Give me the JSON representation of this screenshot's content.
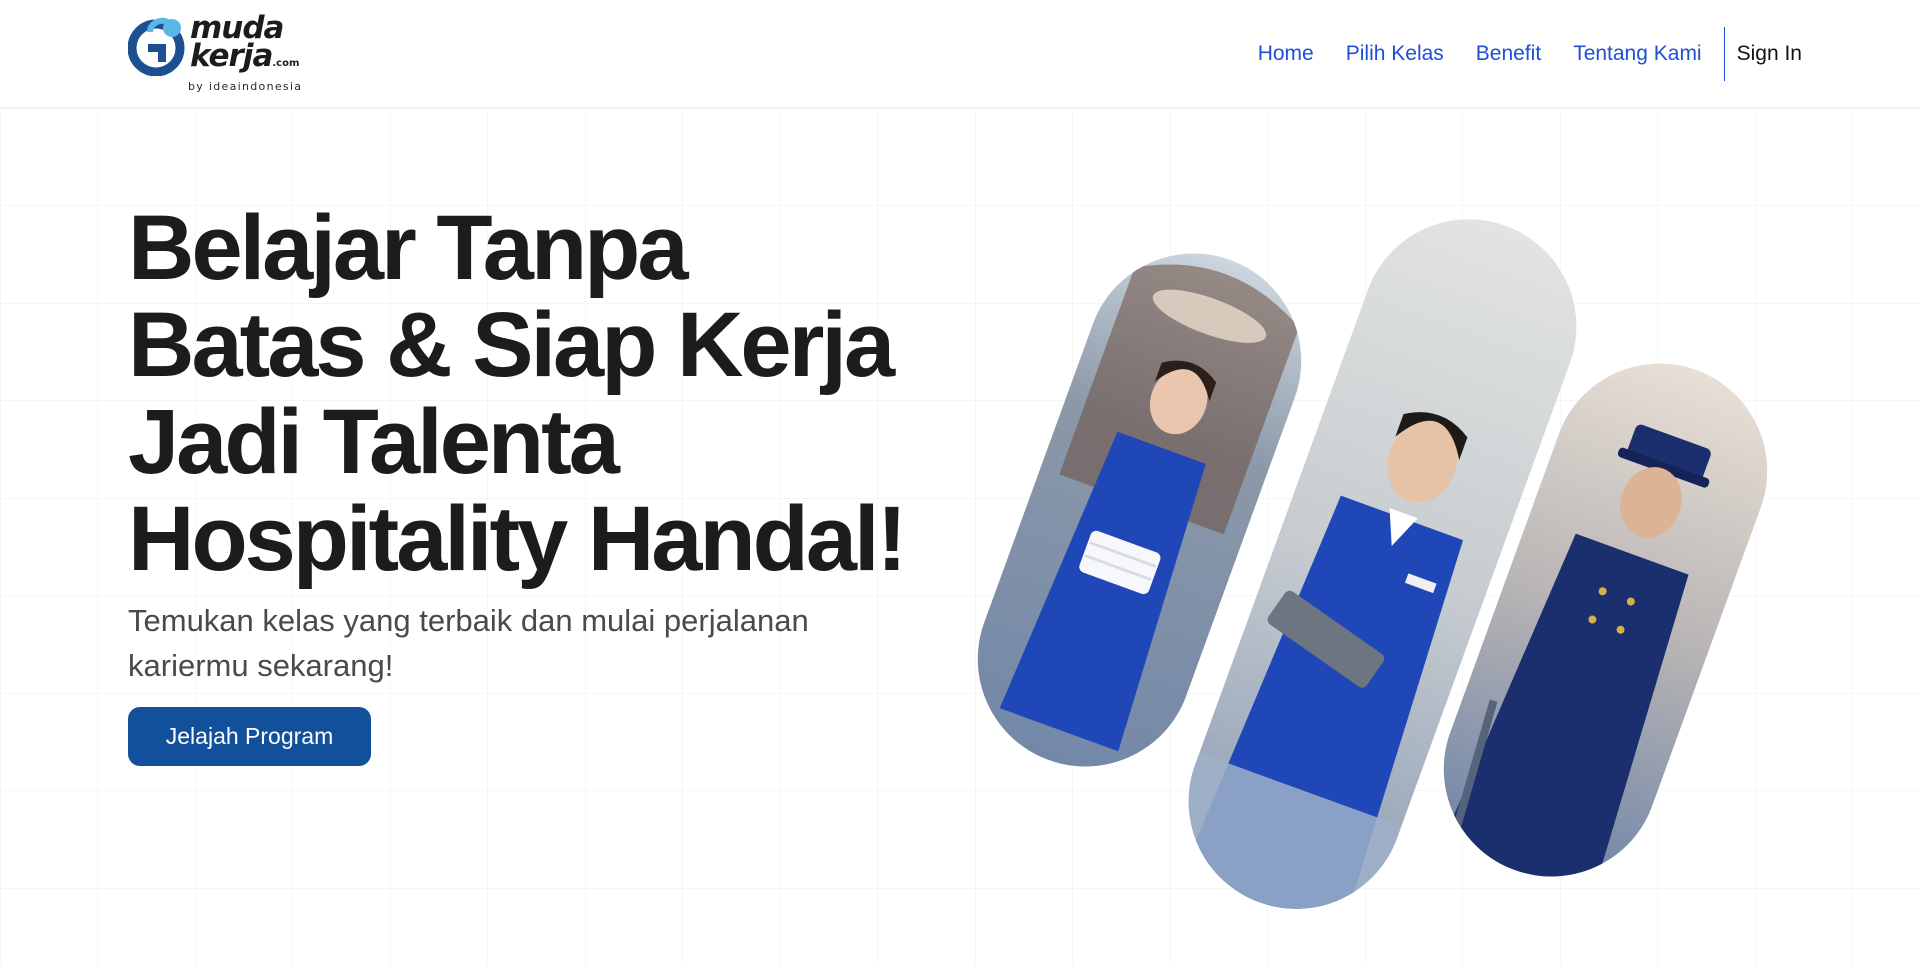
{
  "brand": {
    "name_line1": "muda",
    "name_line2": "kerja",
    "name_suffix": ".com",
    "tagline": "by ideaindonesia",
    "colors": {
      "mark_dark": "#1d4f91",
      "mark_light": "#5bb7e6",
      "text": "#1c1c1c"
    }
  },
  "nav": {
    "items": [
      {
        "label": "Home"
      },
      {
        "label": "Pilih Kelas"
      },
      {
        "label": "Benefit"
      },
      {
        "label": "Tentang Kami"
      }
    ],
    "signin_label": "Sign In",
    "link_color": "#1d4fd8"
  },
  "hero": {
    "headline_lines": [
      "Belajar Tanpa",
      "Batas & Siap Kerja",
      "Jadi Talenta",
      "Hospitality Handal!"
    ],
    "subtext_line1": "Temukan kelas yang terbaik dan mulai perjalanan",
    "subtext_line2": "kariermu sekarang!",
    "cta_label": "Jelajah Program",
    "cta_color": "#12509c"
  },
  "images": [
    {
      "name": "housekeeper-photo",
      "subject": "smiling housekeeper in blue uniform holding folded white towels"
    },
    {
      "name": "front-desk-photo",
      "subject": "smiling front desk staff in blue uniform holding a tablet"
    },
    {
      "name": "bellboy-photo",
      "subject": "smiling bellboy in navy uniform and cap with a luggage cart"
    }
  ]
}
